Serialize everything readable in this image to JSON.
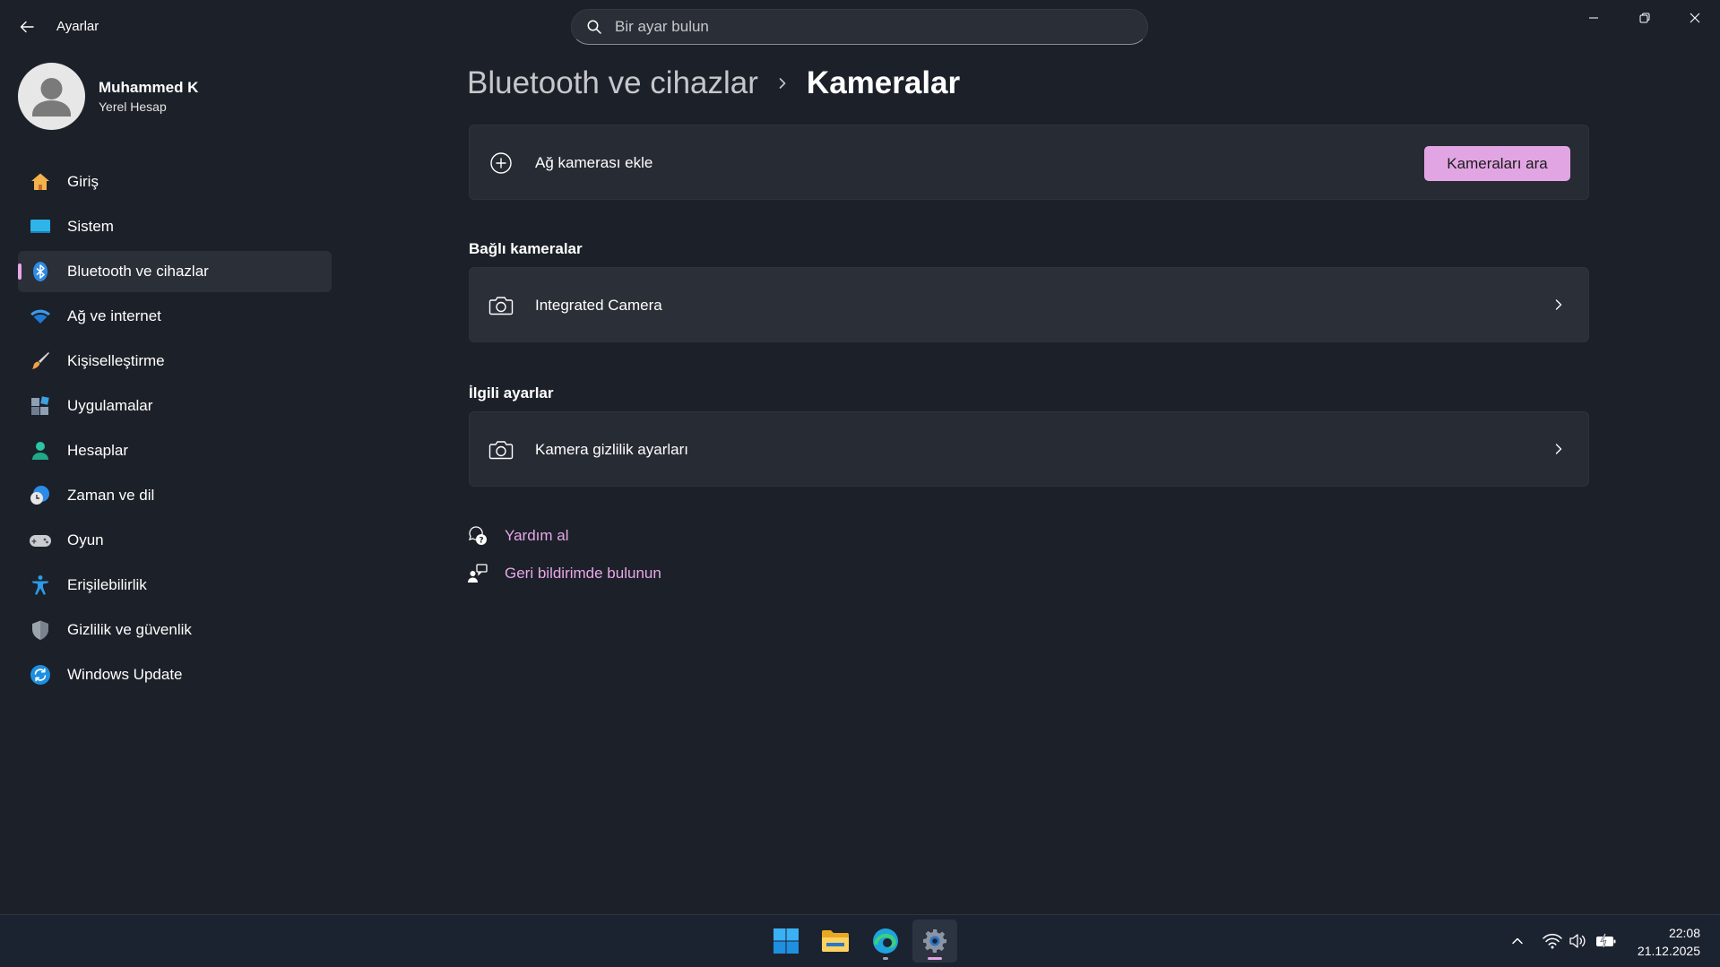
{
  "window": {
    "title": "Ayarlar",
    "search_placeholder": "Bir ayar bulun"
  },
  "profile": {
    "name": "Muhammed K",
    "account_type": "Yerel Hesap"
  },
  "sidebar": {
    "items": [
      {
        "label": "Giriş",
        "icon": "home-icon",
        "active": false
      },
      {
        "label": "Sistem",
        "icon": "system-display-icon",
        "active": false
      },
      {
        "label": "Bluetooth ve cihazlar",
        "icon": "bluetooth-icon",
        "active": true
      },
      {
        "label": "Ağ ve internet",
        "icon": "wifi-icon",
        "active": false
      },
      {
        "label": "Kişiselleştirme",
        "icon": "paintbrush-icon",
        "active": false
      },
      {
        "label": "Uygulamalar",
        "icon": "apps-icon",
        "active": false
      },
      {
        "label": "Hesaplar",
        "icon": "person-icon",
        "active": false
      },
      {
        "label": "Zaman ve dil",
        "icon": "clock-globe-icon",
        "active": false
      },
      {
        "label": "Oyun",
        "icon": "gamepad-icon",
        "active": false
      },
      {
        "label": "Erişilebilirlik",
        "icon": "accessibility-icon",
        "active": false
      },
      {
        "label": "Gizlilik ve güvenlik",
        "icon": "shield-icon",
        "active": false
      },
      {
        "label": "Windows Update",
        "icon": "update-sync-icon",
        "active": false
      }
    ]
  },
  "breadcrumb": {
    "parent": "Bluetooth ve cihazlar",
    "current": "Kameralar"
  },
  "add_camera": {
    "label": "Ağ kamerası ekle",
    "button": "Kameraları ara"
  },
  "connected": {
    "title": "Bağlı kameralar",
    "items": [
      {
        "label": "Integrated Camera"
      }
    ]
  },
  "related": {
    "title": "İlgili ayarlar",
    "items": [
      {
        "label": "Kamera gizlilik ayarları"
      }
    ]
  },
  "links": {
    "help": "Yardım al",
    "feedback": "Geri bildirimde bulunun"
  },
  "taskbar": {
    "time": "22:08",
    "date": "21.12.2025"
  },
  "colors": {
    "accent": "#e2a5e3",
    "background": "#1c2028",
    "card": "#272b33"
  }
}
